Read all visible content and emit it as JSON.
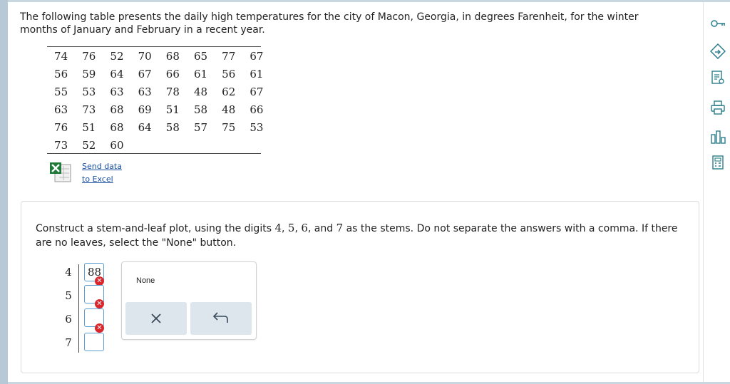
{
  "intro_text": "The following table presents the daily high temperatures for the city of Macon, Georgia, in degrees Farenheit, for the winter months of January and February in a recent year.",
  "temperatures": [
    [
      "74",
      "76",
      "52",
      "70",
      "68",
      "65",
      "77",
      "67"
    ],
    [
      "56",
      "59",
      "64",
      "67",
      "66",
      "61",
      "56",
      "61"
    ],
    [
      "55",
      "53",
      "63",
      "63",
      "78",
      "48",
      "62",
      "67"
    ],
    [
      "63",
      "73",
      "68",
      "69",
      "51",
      "58",
      "48",
      "66"
    ],
    [
      "76",
      "51",
      "68",
      "64",
      "58",
      "57",
      "75",
      "53"
    ],
    [
      "73",
      "52",
      "60",
      "",
      "",
      "",
      "",
      ""
    ]
  ],
  "excel_link": {
    "line1": "Send data",
    "line2": "to Excel"
  },
  "question": {
    "part1": "Construct a stem-and-leaf plot, using the digits ",
    "d1": "4",
    "sep1": ", ",
    "d2": "5",
    "sep2": ", ",
    "d3": "6",
    "sep3": ", and ",
    "d4": "7",
    "part2": " as the stems. Do not separate the answers with a comma. If there are no leaves, select the \"None\" button."
  },
  "stems": [
    "4",
    "5",
    "6",
    "7"
  ],
  "leaves": [
    "88",
    "",
    "",
    ""
  ],
  "palette": {
    "none_label": "None"
  },
  "colors": {
    "error": "#d9262b",
    "accent_border": "#5b9ccf",
    "link": "#1a4fa0",
    "button_bg": "#dde6ed"
  },
  "right_toolbar_icons": [
    "key-icon",
    "hint-icon",
    "notes-icon",
    "print-icon",
    "chart-icon",
    "calculator-icon"
  ]
}
